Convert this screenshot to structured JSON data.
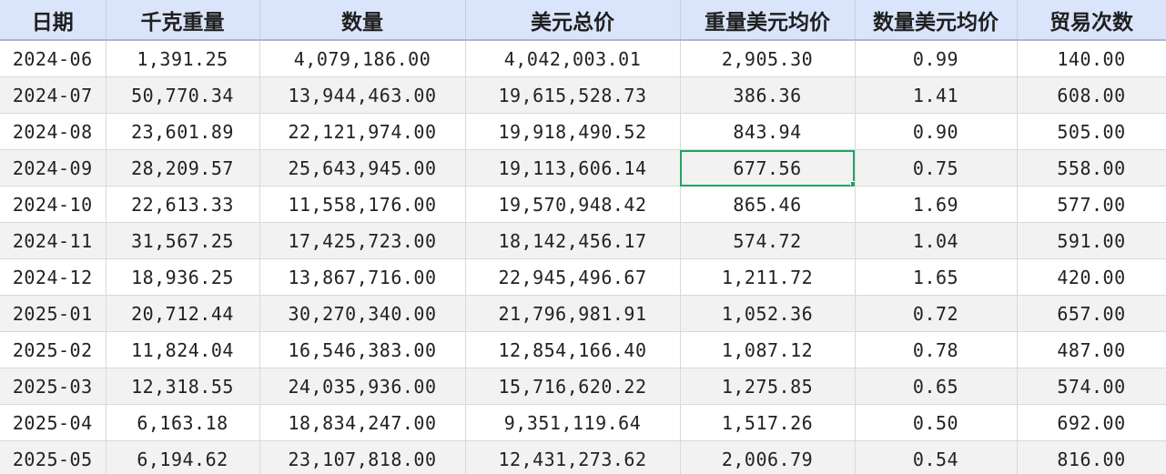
{
  "headers": [
    "日期",
    "千克重量",
    "数量",
    "美元总价",
    "重量美元均价",
    "数量美元均价",
    "贸易次数"
  ],
  "rows": [
    [
      "2024-06",
      "1,391.25",
      "4,079,186.00",
      "4,042,003.01",
      "2,905.30",
      "0.99",
      "140.00"
    ],
    [
      "2024-07",
      "50,770.34",
      "13,944,463.00",
      "19,615,528.73",
      "386.36",
      "1.41",
      "608.00"
    ],
    [
      "2024-08",
      "23,601.89",
      "22,121,974.00",
      "19,918,490.52",
      "843.94",
      "0.90",
      "505.00"
    ],
    [
      "2024-09",
      "28,209.57",
      "25,643,945.00",
      "19,113,606.14",
      "677.56",
      "0.75",
      "558.00"
    ],
    [
      "2024-10",
      "22,613.33",
      "11,558,176.00",
      "19,570,948.42",
      "865.46",
      "1.69",
      "577.00"
    ],
    [
      "2024-11",
      "31,567.25",
      "17,425,723.00",
      "18,142,456.17",
      "574.72",
      "1.04",
      "591.00"
    ],
    [
      "2024-12",
      "18,936.25",
      "13,867,716.00",
      "22,945,496.67",
      "1,211.72",
      "1.65",
      "420.00"
    ],
    [
      "2025-01",
      "20,712.44",
      "30,270,340.00",
      "21,796,981.91",
      "1,052.36",
      "0.72",
      "657.00"
    ],
    [
      "2025-02",
      "11,824.04",
      "16,546,383.00",
      "12,854,166.40",
      "1,087.12",
      "0.78",
      "487.00"
    ],
    [
      "2025-03",
      "12,318.55",
      "24,035,936.00",
      "15,716,620.22",
      "1,275.85",
      "0.65",
      "574.00"
    ],
    [
      "2025-04",
      "6,163.18",
      "18,834,247.00",
      "9,351,119.64",
      "1,517.26",
      "0.50",
      "692.00"
    ],
    [
      "2025-05",
      "6,194.62",
      "23,107,818.00",
      "12,431,273.62",
      "2,006.79",
      "0.54",
      "816.00"
    ]
  ],
  "selection": {
    "row": 3,
    "col": 4,
    "value": "677.56"
  },
  "colors": {
    "header_bg": "#dae5fb",
    "row_alt_bg": "#f2f2f2",
    "selection_border": "#21a366",
    "gridline": "#d9d9d9"
  }
}
